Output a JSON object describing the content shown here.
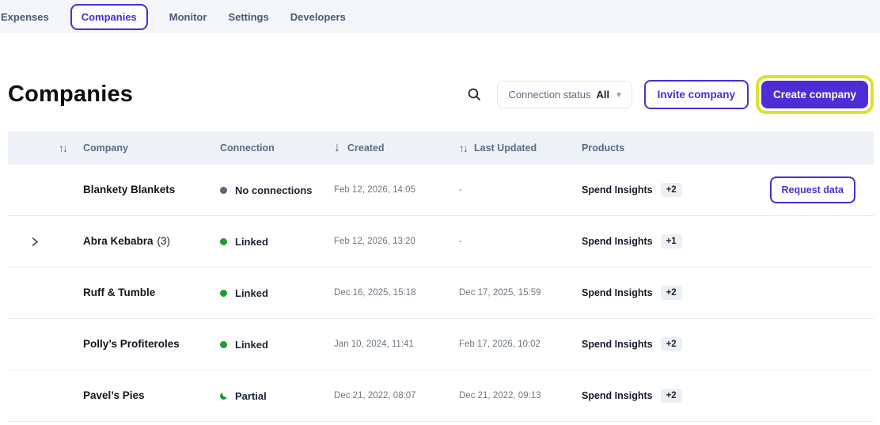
{
  "nav": {
    "items": [
      {
        "label": "Expenses",
        "active": false
      },
      {
        "label": "Companies",
        "active": true
      },
      {
        "label": "Monitor",
        "active": false
      },
      {
        "label": "Settings",
        "active": false
      },
      {
        "label": "Developers",
        "active": false
      }
    ]
  },
  "header": {
    "title": "Companies",
    "filter_label": "Connection status",
    "filter_value": "All",
    "invite_button": "Invite company",
    "create_button": "Create company"
  },
  "icons": {
    "sort_both": "↑↓",
    "sort_down": "↓",
    "dropdown_caret": "▾"
  },
  "colors": {
    "accent_purple": "#4e2cd6",
    "highlight_yellow": "#dce12f",
    "linked_green": "#1f9d33",
    "no_connection_gray": "#5d6779",
    "header_bg": "#eef2f7",
    "navbar_bg": "#f4f6f9"
  },
  "table": {
    "columns": [
      {
        "label": "Company",
        "sort": "both"
      },
      {
        "label": "Connection",
        "sort": "none"
      },
      {
        "label": "Created",
        "sort": "down"
      },
      {
        "label": "Last Updated",
        "sort": "both"
      },
      {
        "label": "Products",
        "sort": "none"
      }
    ],
    "rows": [
      {
        "name": "Blankety Blankets",
        "suffix": "",
        "expandable": false,
        "status": "No connections",
        "status_type": "none",
        "created": "Feb 12, 2026, 14:05",
        "updated": "-",
        "product": "Spend Insights",
        "badge": "+2",
        "action": "Request data"
      },
      {
        "name": "Abra Kebabra",
        "suffix": "(3)",
        "expandable": true,
        "status": "Linked",
        "status_type": "linked",
        "created": "Feb 12, 2026, 13:20",
        "updated": "-",
        "product": "Spend Insights",
        "badge": "+1",
        "action": ""
      },
      {
        "name": "Ruff & Tumble",
        "suffix": "",
        "expandable": false,
        "status": "Linked",
        "status_type": "linked",
        "created": "Dec 16, 2025, 15:18",
        "updated": "Dec 17, 2025, 15:59",
        "product": "Spend Insights",
        "badge": "+2",
        "action": ""
      },
      {
        "name": "Polly’s Profiteroles",
        "suffix": "",
        "expandable": false,
        "status": "Linked",
        "status_type": "linked",
        "created": "Jan 10, 2024, 11:41",
        "updated": "Feb 17, 2026, 10:02",
        "product": "Spend Insights",
        "badge": "+2",
        "action": ""
      },
      {
        "name": "Pavel’s Pies",
        "suffix": "",
        "expandable": false,
        "status": "Partial",
        "status_type": "partial",
        "created": "Dec 21, 2022, 08:07",
        "updated": "Dec 21, 2022, 09:13",
        "product": "Spend Insights",
        "badge": "+2",
        "action": ""
      }
    ]
  }
}
